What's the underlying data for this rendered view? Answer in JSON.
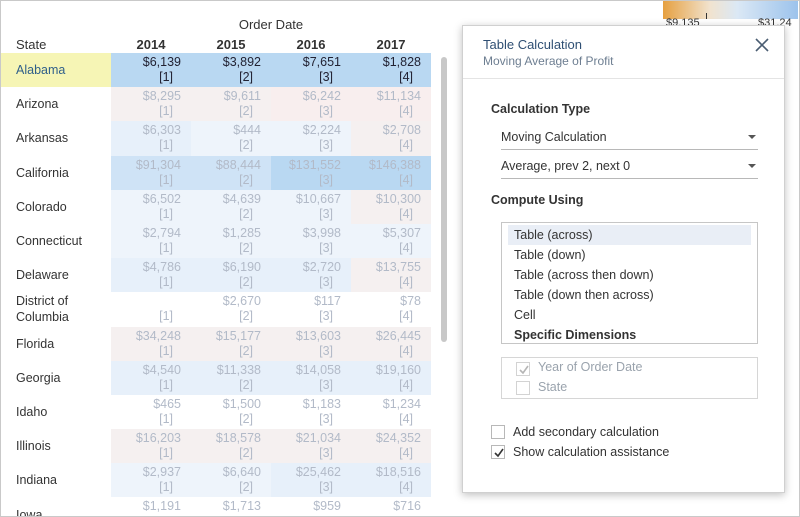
{
  "sheet": {
    "column_title": "Order Date",
    "row_header": "State",
    "years": [
      "2014",
      "2015",
      "2016",
      "2017"
    ],
    "rows": [
      {
        "state": "Alabama",
        "selected": true,
        "shade": [
          "b1",
          "b1",
          "b1",
          "b1"
        ],
        "cells": [
          {
            "value": "$6,139",
            "idx": "[1]"
          },
          {
            "value": "$3,892",
            "idx": "[2]"
          },
          {
            "value": "$7,651",
            "idx": "[3]"
          },
          {
            "value": "$1,828",
            "idx": "[4]"
          }
        ]
      },
      {
        "state": "Arizona",
        "selected": false,
        "shade": [
          "p2",
          "p2",
          "p1",
          "p1"
        ],
        "cells": [
          {
            "value": "$8,295",
            "idx": "[1]"
          },
          {
            "value": "$9,611",
            "idx": "[2]"
          },
          {
            "value": "$6,242",
            "idx": "[3]"
          },
          {
            "value": "$11,134",
            "idx": "[4]"
          }
        ]
      },
      {
        "state": "Arkansas",
        "selected": false,
        "shade": [
          "b4",
          "b5",
          "b5",
          "p2"
        ],
        "cells": [
          {
            "value": "$6,303",
            "idx": "[1]"
          },
          {
            "value": "$444",
            "idx": "[2]"
          },
          {
            "value": "$2,224",
            "idx": "[3]"
          },
          {
            "value": "$2,708",
            "idx": "[4]"
          }
        ]
      },
      {
        "state": "California",
        "selected": false,
        "shade": [
          "b2",
          "b2",
          "b1",
          "b1"
        ],
        "cells": [
          {
            "value": "$91,304",
            "idx": "[1]"
          },
          {
            "value": "$88,444",
            "idx": "[2]"
          },
          {
            "value": "$131,552",
            "idx": "[3]"
          },
          {
            "value": "$146,388",
            "idx": "[4]"
          }
        ]
      },
      {
        "state": "Colorado",
        "selected": false,
        "shade": [
          "b5",
          "b5",
          "b5",
          "p2"
        ],
        "cells": [
          {
            "value": "$6,502",
            "idx": "[1]"
          },
          {
            "value": "$4,639",
            "idx": "[2]"
          },
          {
            "value": "$10,667",
            "idx": "[3]"
          },
          {
            "value": "$10,300",
            "idx": "[4]"
          }
        ]
      },
      {
        "state": "Connecticut",
        "selected": false,
        "shade": [
          "b5",
          "b5",
          "b5",
          "b5"
        ],
        "cells": [
          {
            "value": "$2,794",
            "idx": "[1]"
          },
          {
            "value": "$1,285",
            "idx": "[2]"
          },
          {
            "value": "$3,998",
            "idx": "[3]"
          },
          {
            "value": "$5,307",
            "idx": "[4]"
          }
        ]
      },
      {
        "state": "Delaware",
        "selected": false,
        "shade": [
          "b4",
          "b4",
          "b4",
          "p2"
        ],
        "cells": [
          {
            "value": "$4,786",
            "idx": "[1]"
          },
          {
            "value": "$6,190",
            "idx": "[2]"
          },
          {
            "value": "$2,720",
            "idx": "[3]"
          },
          {
            "value": "$13,755",
            "idx": "[4]"
          }
        ]
      },
      {
        "state": "District of Columbia",
        "selected": false,
        "shade": [
          "",
          "",
          "",
          ""
        ],
        "cells": [
          {
            "value": "",
            "idx": "[1]"
          },
          {
            "value": "$2,670",
            "idx": "[2]"
          },
          {
            "value": "$117",
            "idx": "[3]"
          },
          {
            "value": "$78",
            "idx": "[4]"
          }
        ]
      },
      {
        "state": "Florida",
        "selected": false,
        "shade": [
          "p2",
          "p2",
          "p2",
          "p2"
        ],
        "cells": [
          {
            "value": "$34,248",
            "idx": "[1]"
          },
          {
            "value": "$15,177",
            "idx": "[2]"
          },
          {
            "value": "$13,603",
            "idx": "[3]"
          },
          {
            "value": "$26,445",
            "idx": "[4]"
          }
        ]
      },
      {
        "state": "Georgia",
        "selected": false,
        "shade": [
          "b4",
          "b4",
          "b4",
          "b4"
        ],
        "cells": [
          {
            "value": "$4,540",
            "idx": "[1]"
          },
          {
            "value": "$11,338",
            "idx": "[2]"
          },
          {
            "value": "$14,058",
            "idx": "[3]"
          },
          {
            "value": "$19,160",
            "idx": "[4]"
          }
        ]
      },
      {
        "state": "Idaho",
        "selected": false,
        "shade": [
          "",
          "",
          "",
          ""
        ],
        "cells": [
          {
            "value": "$465",
            "idx": "[1]"
          },
          {
            "value": "$1,500",
            "idx": "[2]"
          },
          {
            "value": "$1,183",
            "idx": "[3]"
          },
          {
            "value": "$1,234",
            "idx": "[4]"
          }
        ]
      },
      {
        "state": "Illinois",
        "selected": false,
        "shade": [
          "p2",
          "p2",
          "p2",
          "p2"
        ],
        "cells": [
          {
            "value": "$16,203",
            "idx": "[1]"
          },
          {
            "value": "$18,578",
            "idx": "[2]"
          },
          {
            "value": "$21,034",
            "idx": "[3]"
          },
          {
            "value": "$24,352",
            "idx": "[4]"
          }
        ]
      },
      {
        "state": "Indiana",
        "selected": false,
        "shade": [
          "b5",
          "b5",
          "b4",
          "b4"
        ],
        "cells": [
          {
            "value": "$2,937",
            "idx": "[1]"
          },
          {
            "value": "$6,640",
            "idx": "[2]"
          },
          {
            "value": "$25,462",
            "idx": "[3]"
          },
          {
            "value": "$18,516",
            "idx": "[4]"
          }
        ]
      },
      {
        "state": "Iowa",
        "selected": false,
        "shade": [
          "",
          "",
          "",
          ""
        ],
        "cells": [
          {
            "value": "$1,191",
            "idx": ""
          },
          {
            "value": "$1,713",
            "idx": ""
          },
          {
            "value": "$959",
            "idx": ""
          },
          {
            "value": "$716",
            "idx": ""
          }
        ]
      }
    ]
  },
  "legend": {
    "left_label": "$9,135",
    "right_label": "$31,24"
  },
  "dialog": {
    "title": "Table Calculation",
    "subtitle": "Moving Average of Profit",
    "calc_type_label": "Calculation Type",
    "calc_type_value": "Moving Calculation",
    "calc_summary_value": "Average, prev 2, next 0",
    "compute_label": "Compute Using",
    "compute_options": [
      {
        "label": "Table (across)",
        "active": true,
        "strong": false
      },
      {
        "label": "Table (down)",
        "active": false,
        "strong": false
      },
      {
        "label": "Table (across then down)",
        "active": false,
        "strong": false
      },
      {
        "label": "Table (down then across)",
        "active": false,
        "strong": false
      },
      {
        "label": "Cell",
        "active": false,
        "strong": false
      },
      {
        "label": "Specific Dimensions",
        "active": false,
        "strong": true
      }
    ],
    "dimensions": [
      {
        "label": "Year of Order Date",
        "checked": true
      },
      {
        "label": "State",
        "checked": false
      }
    ],
    "secondary_label": "Add secondary calculation",
    "secondary_checked": false,
    "assist_label": "Show calculation assistance",
    "assist_checked": true
  },
  "icons": {
    "close": "close-icon",
    "check": "checkmark-icon",
    "dropdown": "chevron-down-icon"
  }
}
